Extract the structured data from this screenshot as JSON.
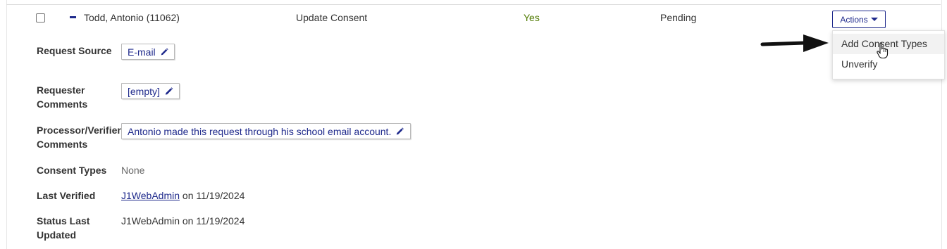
{
  "row": {
    "name": "Todd, Antonio (11062)",
    "request_type": "Update Consent",
    "flag": "Yes",
    "status": "Pending",
    "actions_label": "Actions"
  },
  "menu": {
    "items": [
      "Add Consent Types",
      "Unverify"
    ]
  },
  "details": {
    "request_source_label": "Request Source",
    "request_source_value": "E-mail",
    "requester_comments_label_1": "Requester",
    "requester_comments_label_2": "Comments",
    "requester_comments_value": "[empty]",
    "processor_label_1": "Processor/Verifier",
    "processor_label_2": "Comments",
    "processor_value": "Antonio made this request through his school email account.",
    "consent_types_label": "Consent Types",
    "consent_types_value": "None",
    "last_verified_label": "Last Verified",
    "last_verified_user": "J1WebAdmin",
    "last_verified_on": "on 11/19/2024",
    "status_updated_label_1": "Status Last",
    "status_updated_label_2": "Updated",
    "status_updated_value": "J1WebAdmin on 11/19/2024"
  },
  "colors": {
    "accent": "#1f2a8c",
    "yes_green": "#4f7a00"
  }
}
